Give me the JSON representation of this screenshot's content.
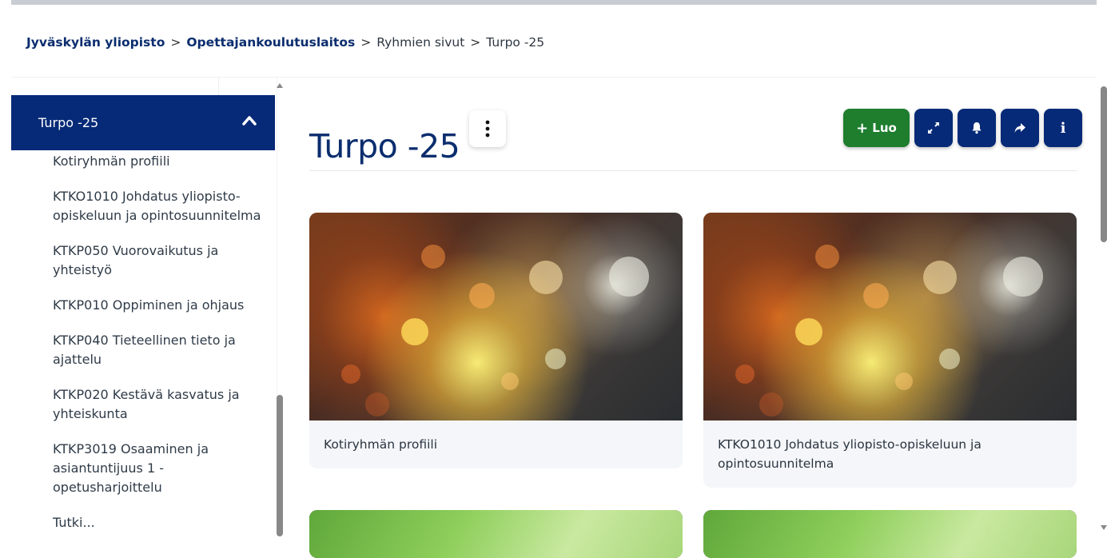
{
  "breadcrumb": {
    "items": [
      "Jyväskylän yliopisto",
      "Opettajankoulutuslaitos",
      "Ryhmien sivut",
      "Turpo -25"
    ],
    "separator": ">"
  },
  "sidebar": {
    "header_title": "Turpo -25",
    "header_icon": "chevron-up-icon",
    "items": [
      "Kotiryhmän profiili",
      "KTKO1010 Johdatus yliopisto-opiskeluun ja opintosuunnitelma",
      "KTKP050 Vuorovaikutus ja yhteistyö",
      "KTKP010 Oppiminen ja ohjaus",
      "KTKP040 Tieteellinen tieto ja ajattelu",
      "KTKP020 Kestävä kasvatus ja yhteiskunta",
      "KTKP3019 Osaaminen ja asiantuntijuus 1 - opetusharjoittelu",
      "Tutki..."
    ]
  },
  "main": {
    "title": "Turpo -25",
    "actions": {
      "create_label": "Luo",
      "create_icon": "plus-icon",
      "expand_icon": "expand-icon",
      "notify_icon": "bell-icon",
      "share_icon": "share-arrow-icon",
      "info_label": "i"
    },
    "cards": [
      {
        "caption": "Kotiryhmän profiili",
        "image": "bokeh-lights"
      },
      {
        "caption": "KTKO1010 Johdatus yliopisto-opiskeluun ja opintosuunnitelma",
        "image": "bokeh-lights"
      },
      {
        "caption": "",
        "image": "green-abstract"
      },
      {
        "caption": "",
        "image": "green-abstract"
      }
    ]
  },
  "colors": {
    "brand_navy": "#062a77",
    "create_green": "#1e7e2e",
    "title_blue": "#0b2d6e"
  }
}
